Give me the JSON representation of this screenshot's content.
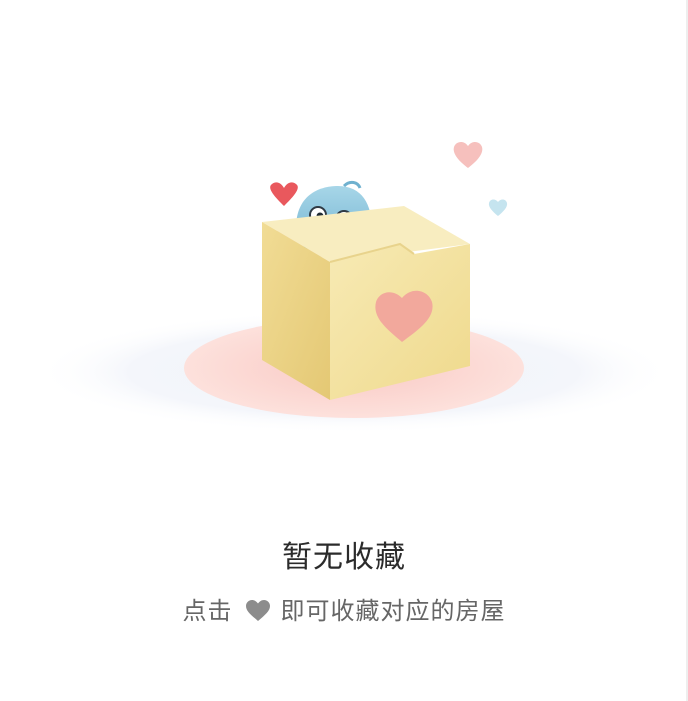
{
  "empty_state": {
    "title": "暂无收藏",
    "hint_prefix": "点击",
    "hint_icon": "heart-icon",
    "hint_suffix": "即可收藏对应的房屋"
  },
  "colors": {
    "title_text": "#2b2b2b",
    "hint_text": "#666666",
    "hint_heart": "#8c8c8c",
    "box": "#f3e3a0",
    "heart_pink": "#f3a7a0",
    "mascot_blue": "#86c4dc"
  }
}
